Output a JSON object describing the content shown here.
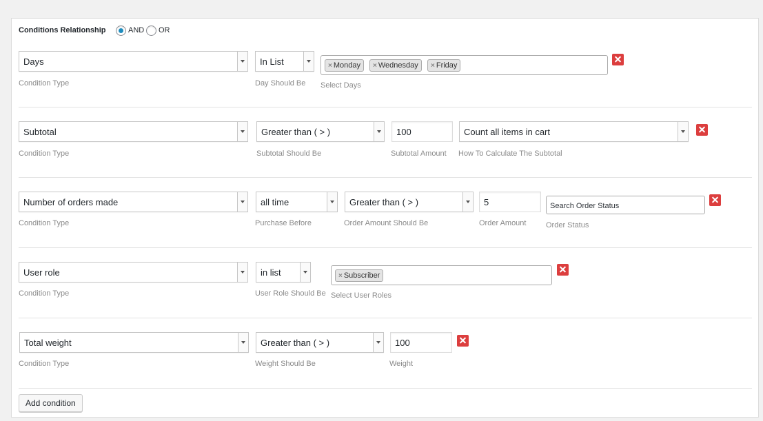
{
  "relationship": {
    "label": "Conditions Relationship",
    "options": [
      "AND",
      "OR"
    ],
    "selected": "AND"
  },
  "conditions": [
    {
      "type": "Days",
      "type_label": "Condition Type",
      "operator": "In List",
      "operator_label": "Day Should Be",
      "values": [
        "Monday",
        "Wednesday",
        "Friday"
      ],
      "values_label": "Select Days"
    },
    {
      "type": "Subtotal",
      "type_label": "Condition Type",
      "operator": "Greater than ( > )",
      "operator_label": "Subtotal Should Be",
      "amount": "100",
      "amount_label": "Subtotal Amount",
      "calc": "Count all items in cart",
      "calc_label": "How To Calculate The Subtotal"
    },
    {
      "type": "Number of orders made",
      "type_label": "Condition Type",
      "period": "all time",
      "period_label": "Purchase Before",
      "operator": "Greater than ( > )",
      "operator_label": "Order Amount Should Be",
      "amount": "5",
      "amount_label": "Order Amount",
      "status_placeholder": "Search Order Status",
      "status_label": "Order Status"
    },
    {
      "type": "User role",
      "type_label": "Condition Type",
      "operator": "in list",
      "operator_label": "User Role Should Be",
      "values": [
        "Subscriber"
      ],
      "values_label": "Select User Roles"
    },
    {
      "type": "Total weight",
      "type_label": "Condition Type",
      "operator": "Greater than ( > )",
      "operator_label": "Weight Should Be",
      "amount": "100",
      "amount_label": "Weight"
    }
  ],
  "add_button": "Add condition",
  "colors": {
    "accent": "#1e8cbe",
    "delete": "#dc3e3e"
  }
}
